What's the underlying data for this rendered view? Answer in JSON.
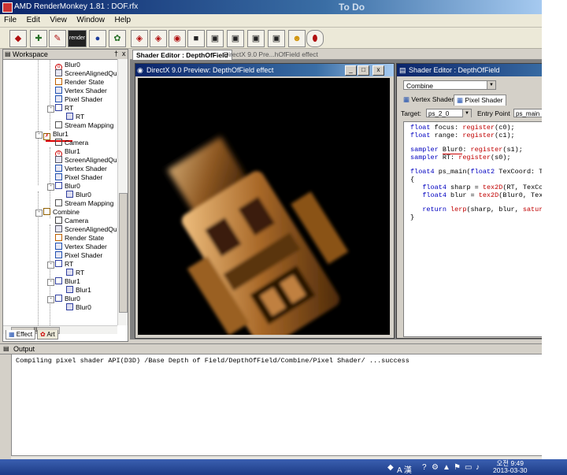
{
  "app": {
    "title": "AMD RenderMonkey 1.81 : DOF.rfx",
    "overlay_text": "To Do"
  },
  "menu": [
    "File",
    "Edit",
    "View",
    "Window",
    "Help"
  ],
  "toolbar": {
    "render_label": "render"
  },
  "workspace": {
    "title": "Workspace",
    "pin_glyph": "†",
    "close_glyph": "x",
    "tree": [
      {
        "label": "Blur0",
        "icon": "red-circle-icon"
      },
      {
        "label": "ScreenAlignedQuad",
        "icon": "quad-icon"
      },
      {
        "label": "Render State",
        "icon": "render-state-icon"
      },
      {
        "label": "Vertex Shader",
        "icon": "vertex-shader-icon"
      },
      {
        "label": "Pixel Shader",
        "icon": "pixel-shader-icon"
      },
      {
        "label": "RT",
        "icon": "render-target-icon"
      },
      {
        "label": "RT",
        "icon": "texture-icon"
      },
      {
        "label": "Stream Mapping",
        "icon": "stream-mapping-icon"
      },
      {
        "label": "Blur1",
        "icon": "pass-icon"
      },
      {
        "label": "Camera",
        "icon": "camera-icon"
      },
      {
        "label": "Blur1",
        "icon": "red-circle-icon"
      },
      {
        "label": "ScreenAlignedQuad",
        "icon": "quad-icon"
      },
      {
        "label": "Vertex Shader",
        "icon": "vertex-shader-icon"
      },
      {
        "label": "Pixel Shader",
        "icon": "pixel-shader-icon"
      },
      {
        "label": "Blur0",
        "icon": "render-target-icon"
      },
      {
        "label": "Blur0",
        "icon": "texture-icon"
      },
      {
        "label": "Stream Mapping",
        "icon": "stream-mapping-icon"
      },
      {
        "label": "Combine",
        "icon": "pass-icon"
      },
      {
        "label": "Camera",
        "icon": "camera-icon"
      },
      {
        "label": "ScreenAlignedQuad",
        "icon": "quad-icon"
      },
      {
        "label": "Render State",
        "icon": "render-state-icon"
      },
      {
        "label": "Vertex Shader",
        "icon": "vertex-shader-icon"
      },
      {
        "label": "Pixel Shader",
        "icon": "pixel-shader-icon"
      },
      {
        "label": "RT",
        "icon": "render-target-icon"
      },
      {
        "label": "RT",
        "icon": "texture-icon"
      },
      {
        "label": "Blur1",
        "icon": "render-target-icon"
      },
      {
        "label": "Blur1",
        "icon": "texture-icon"
      },
      {
        "label": "Blur0",
        "icon": "render-target-icon"
      },
      {
        "label": "Blur0",
        "icon": "texture-icon"
      }
    ],
    "tabs": [
      "Effect",
      "Art"
    ]
  },
  "editor_tabs": [
    "Shader Editor : DepthOfField",
    "DirectX 9.0 Pre...hOfField effect"
  ],
  "preview": {
    "title": "DirectX 9.0 Preview: DepthOfField effect",
    "min": "_",
    "max": "□",
    "close": "x"
  },
  "shader_editor": {
    "title": "Shader Editor : DepthOfField",
    "pass": "Combine",
    "tabs": [
      "Vertex Shader",
      "Pixel Shader"
    ],
    "target_label": "Target:",
    "target": "ps_2_0",
    "entry_label": "Entry Point",
    "entry": "ps_main",
    "code": [
      "float focus: register(c0);",
      "float range: register(c1);",
      "",
      "sampler Blur0: register(s1);",
      "sampler RT: register(s0);",
      "",
      "float4 ps_main(float2 TexCoord: T",
      "{",
      "   float4 sharp = tex2D(RT, TexCo",
      "   float4 blur = tex2D(Blur0, Tex",
      "",
      "   return lerp(sharp, blur, satur",
      "}"
    ]
  },
  "output": {
    "title": "Output",
    "text": "Compiling pixel shader API(D3D) /Base Depth of Field/DepthOfField/Combine/Pixel Shader/ ...success"
  },
  "tray": {
    "ime": "A 漢",
    "time": "오전 9:49",
    "date": "2013-03-30"
  }
}
